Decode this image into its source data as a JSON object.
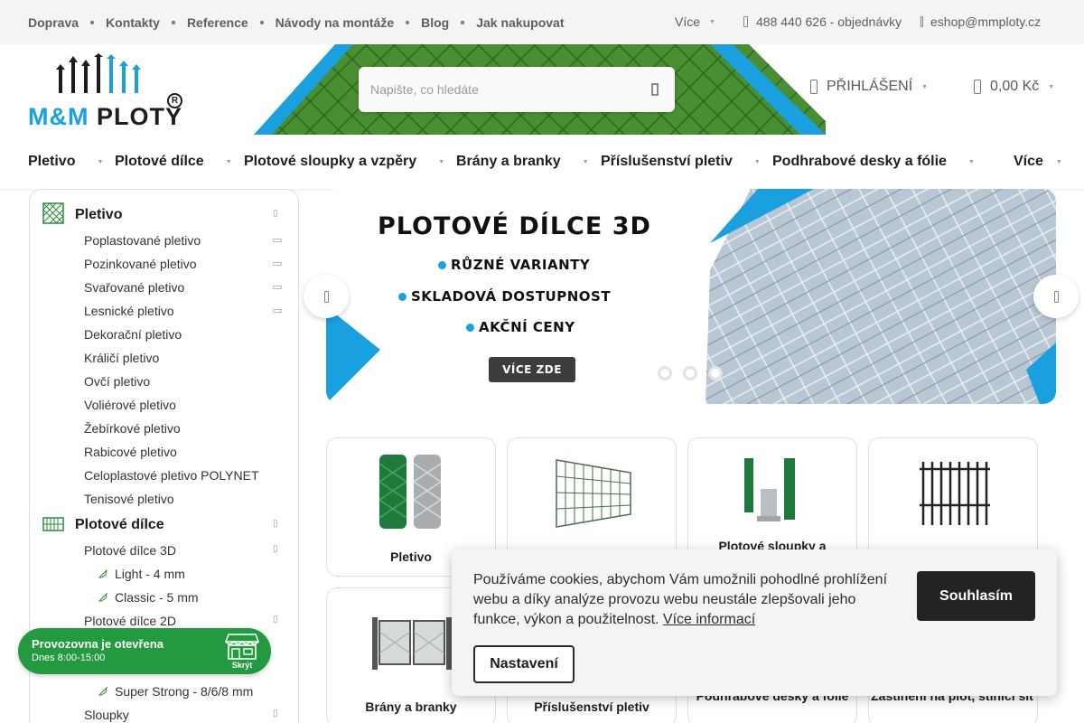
{
  "topbar": {
    "links": [
      "Doprava",
      "Kontakty",
      "Reference",
      "Návody na montáže",
      "Blog",
      "Jak nakupovat"
    ],
    "more_label": "Více",
    "phone": "488 440 626 - objednávky",
    "email": "eshop@mmploty.cz"
  },
  "header": {
    "logo_prefix": "M&M",
    "logo_name": "PLOTY",
    "logo_mark": "R",
    "search_placeholder": "Napište, co hledáte",
    "login_label": "PŘIHLÁŠENÍ",
    "cart_total": "0,00 Kč"
  },
  "mainnav": {
    "items": [
      "Pletivo",
      "Plotové dílce",
      "Plotové sloupky a vzpěry",
      "Brány a branky",
      "Příslušenství pletiv",
      "Podhrabové desky a fólie"
    ],
    "more_label": "Více"
  },
  "sidebar": {
    "cat1": {
      "label": "Pletivo",
      "items": [
        "Poplastované pletivo",
        "Pozinkované pletivo",
        "Svařované pletivo",
        "Lesnické pletivo",
        "Dekorační pletivo",
        "Králičí pletivo",
        "Ovčí pletivo",
        "Voliérové pletivo",
        "Žebírkové pletivo",
        "Rabicové pletivo",
        "Celoplastové pletivo POLYNET",
        "Tenisové pletivo"
      ]
    },
    "cat2": {
      "label": "Plotové dílce",
      "items": [
        "Plotové dílce 3D",
        "Plotové dílce 2D"
      ],
      "sub3d": [
        "Light - 4 mm",
        "Classic - 5 mm"
      ],
      "sub2d": [
        "Super Strong - 8/6/8 mm"
      ]
    },
    "cat3_item": "Sloupky"
  },
  "hero": {
    "title": "PLOTOVÉ DÍLCE 3D",
    "bullets": [
      "RŮZNÉ VARIANTY",
      "SKLADOVÁ DOSTUPNOST",
      "AKČNÍ CENY"
    ],
    "cta": "VÍCE ZDE",
    "slide_count": 3
  },
  "tiles": [
    "Pletivo",
    "Plotové sloupky a",
    "Brány a branky",
    "Příslušenství pletiv",
    "Podhrabové desky a fólie",
    "Zastínění na plot, stínicí síť"
  ],
  "store": {
    "status": "Provozovna je otevřena",
    "hours": "Dnes 8:00-15:00",
    "hide_label": "Skrýt"
  },
  "cookie": {
    "text": "Používáme cookies, abychom Vám umožnili pohodlné prohlížení webu a díky analýze provozu webu neustále zlepšovali jeho funkce, výkon a použitelnost.",
    "link": "Více informací",
    "accept": "Souhlasím",
    "settings": "Nastavení"
  },
  "colors": {
    "brand_blue": "#1a9fdf",
    "store_green": "#239a3f",
    "dark": "#232323"
  }
}
